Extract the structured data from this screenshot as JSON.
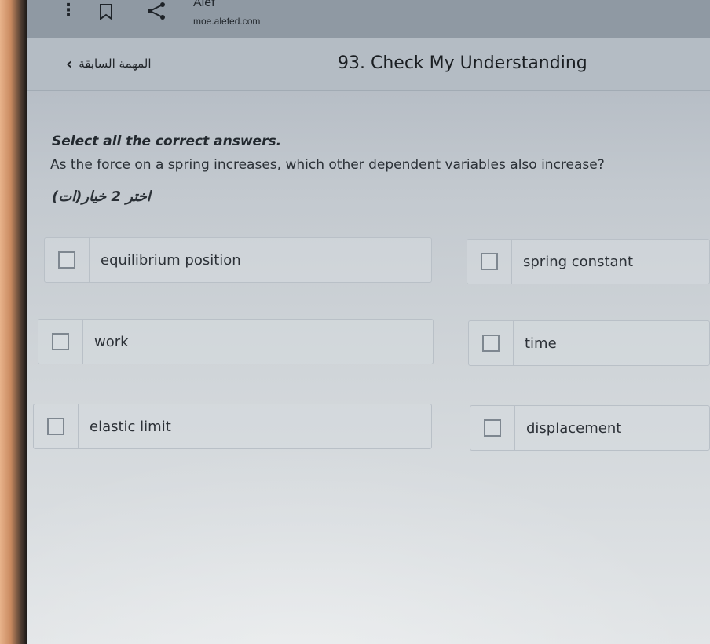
{
  "browser": {
    "site_name": "Alef",
    "url": "moe.alefed.com",
    "menu_icon": "kebab-menu-icon",
    "bookmark_icon": "bookmark-icon",
    "share_icon": "share-icon"
  },
  "header": {
    "back_label": "المهمة السابقة",
    "back_icon": "chevron-left-icon",
    "title": "93. Check My Understanding"
  },
  "question": {
    "instruction": "Select all the correct answers.",
    "prompt": "As the force on a spring increases, which other dependent variables also increase?",
    "hint": "اختر 2 خيار(ات)"
  },
  "options": [
    {
      "label": "equilibrium position",
      "checked": false
    },
    {
      "label": "spring constant",
      "checked": false
    },
    {
      "label": "work",
      "checked": false
    },
    {
      "label": "time",
      "checked": false
    },
    {
      "label": "elastic limit",
      "checked": false
    },
    {
      "label": "displacement",
      "checked": false
    }
  ],
  "colors": {
    "header_bg": "#b4bcc4",
    "browser_bar_bg": "#8f99a3",
    "text": "#2a3036",
    "checkbox_border": "#7e8790"
  }
}
